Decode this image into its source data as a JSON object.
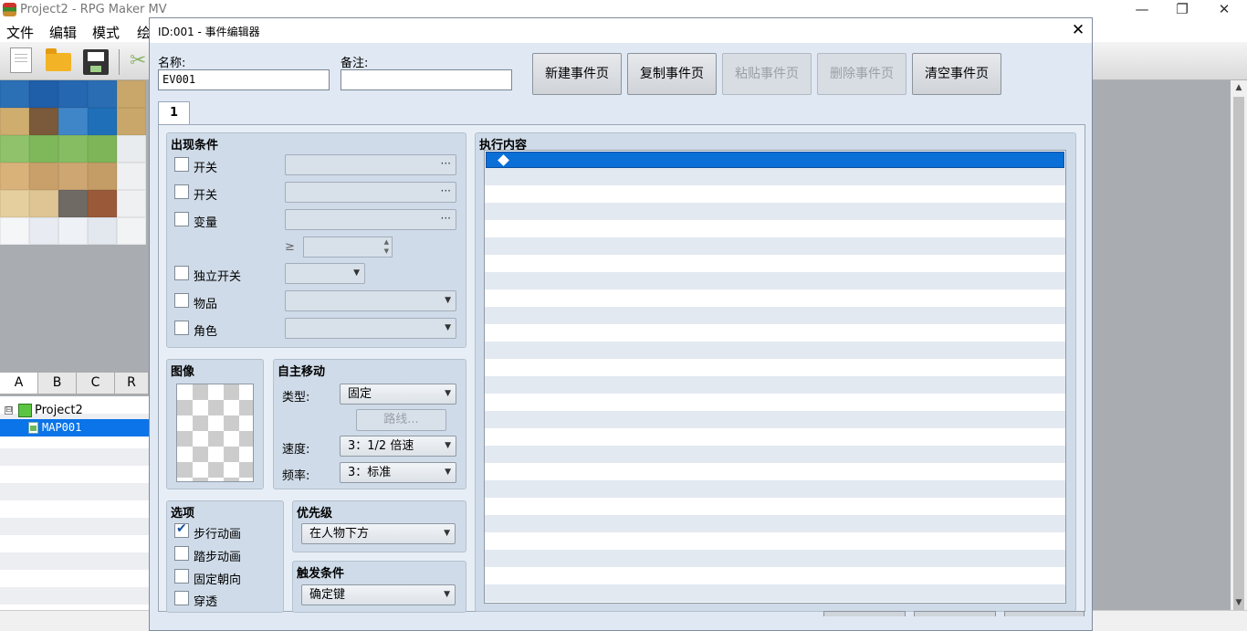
{
  "main_window": {
    "title": "Project2 - RPG Maker MV",
    "controls": {
      "minimize": "—",
      "restore": "❐",
      "close": "✕"
    },
    "menu": [
      "文件",
      "编辑",
      "模式",
      "绘"
    ],
    "toolbar": [
      "new-project-icon",
      "open-project-icon",
      "save-project-icon",
      "cut-icon"
    ],
    "tileset_tabs": [
      "A",
      "B",
      "C",
      "R"
    ],
    "tree": {
      "project": "Project2",
      "expander": "⊟",
      "map": "MAP001"
    }
  },
  "dialog": {
    "title": "ID:001 - 事件编辑器",
    "close": "✕",
    "name_label": "名称:",
    "name_value": "EV001",
    "note_label": "备注:",
    "note_value": "",
    "buttons": {
      "new_page": "新建事件页",
      "copy_page": "复制事件页",
      "paste_page": "粘贴事件页",
      "delete_page": "删除事件页",
      "clear_page": "清空事件页"
    },
    "tab": "1",
    "conditions": {
      "title": "出现条件",
      "switch1": "开关",
      "switch2": "开关",
      "variable": "变量",
      "gte": "≥",
      "self_switch": "独立开关",
      "item": "物品",
      "actor": "角色",
      "dots": "···"
    },
    "image": {
      "title": "图像"
    },
    "autonomous": {
      "title": "自主移动",
      "type_label": "类型:",
      "type_value": "固定",
      "route_button": "路线...",
      "speed_label": "速度:",
      "speed_value": "3：1/2 倍速",
      "freq_label": "频率:",
      "freq_value": "3：标准"
    },
    "options": {
      "title": "选项",
      "walking": "步行动画",
      "walking_checked": true,
      "stepping": "踏步动画",
      "direction_fix": "固定朝向",
      "through": "穿透"
    },
    "priority": {
      "title": "优先级",
      "value": "在人物下方"
    },
    "trigger": {
      "title": "触发条件",
      "value": "确定键"
    },
    "contents": {
      "title": "执行内容"
    }
  },
  "colors": {
    "selection": "#0a6fd6",
    "dialog_bg": "#dfe8f3",
    "group_bg": "#cfdbe8"
  }
}
